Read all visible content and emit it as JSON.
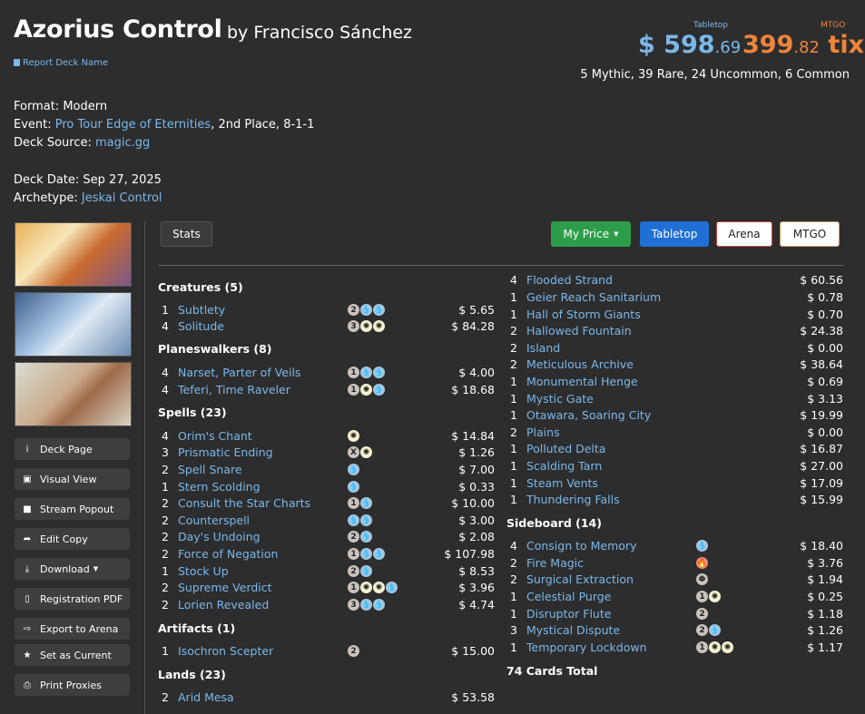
{
  "header": {
    "title": "Azorius Control",
    "author": "by Francisco Sánchez",
    "report_link": "Report Deck Name",
    "tabletop_label": "Tabletop",
    "mtgo_label": "MTGO",
    "tabletop_price_main": "$ 598",
    "tabletop_price_cents": ".69",
    "mtgo_price_main": "399",
    "mtgo_price_cents": ".82",
    "mtgo_price_unit": " tix",
    "rarity": "5 Mythic, 39 Rare, 24 Uncommon, 6 Common"
  },
  "info": {
    "format_label": "Format:",
    "format": "Modern",
    "event_label": "Event:",
    "event_link": "Pro Tour Edge of Eternities",
    "event_rest": ", 2nd Place, 8-1-1",
    "source_label": "Deck Source:",
    "source_link": "magic.gg",
    "date_label": "Deck Date:",
    "date": "Sep 27, 2025",
    "archetype_label": "Archetype:",
    "archetype_link": "Jeskai Control"
  },
  "sidebar": {
    "buttons": [
      {
        "label": "Deck Page",
        "icon": "info-icon"
      },
      {
        "label": "Visual View",
        "icon": "image-icon"
      },
      {
        "label": "Stream Popout",
        "icon": "video-icon"
      },
      {
        "label": "Edit Copy",
        "icon": "share-icon"
      },
      {
        "label": "Download",
        "icon": "download-icon"
      },
      {
        "label": "Registration PDF",
        "icon": "pdf-icon"
      },
      {
        "label": "Export to Arena",
        "icon": "export-icon"
      },
      {
        "label": "Set as Current",
        "icon": "star-icon"
      },
      {
        "label": "Print Proxies",
        "icon": "print-icon"
      }
    ]
  },
  "toolbar": {
    "stats": "Stats",
    "my_price": "My Price",
    "tabletop": "Tabletop",
    "arena": "Arena",
    "mtgo": "MTGO"
  },
  "colors": {
    "link": "#7ab8ea",
    "tabletop_price": "#7ab8ea",
    "mtgo_price": "#f0843a",
    "my_price_btn": "#2e9d4a",
    "tabletop_btn": "#1f6fd4"
  },
  "left_sections": [
    {
      "header": "Creatures (5)",
      "cards": [
        {
          "qty": "1",
          "name": "Subtlety",
          "cost": [
            "2",
            "U",
            "U"
          ],
          "price": "$ 5.65"
        },
        {
          "qty": "4",
          "name": "Solitude",
          "cost": [
            "3",
            "W",
            "W"
          ],
          "price": "$ 84.28"
        }
      ]
    },
    {
      "header": "Planeswalkers (8)",
      "cards": [
        {
          "qty": "4",
          "name": "Narset, Parter of Veils",
          "cost": [
            "1",
            "U",
            "U"
          ],
          "price": "$ 4.00"
        },
        {
          "qty": "4",
          "name": "Teferi, Time Raveler",
          "cost": [
            "1",
            "W",
            "U"
          ],
          "price": "$ 18.68"
        }
      ]
    },
    {
      "header": "Spells (23)",
      "cards": [
        {
          "qty": "4",
          "name": "Orim's Chant",
          "cost": [
            "W"
          ],
          "price": "$ 14.84"
        },
        {
          "qty": "3",
          "name": "Prismatic Ending",
          "cost": [
            "X",
            "W"
          ],
          "price": "$ 1.26"
        },
        {
          "qty": "2",
          "name": "Spell Snare",
          "cost": [
            "U"
          ],
          "price": "$ 7.00"
        },
        {
          "qty": "1",
          "name": "Stern Scolding",
          "cost": [
            "U"
          ],
          "price": "$ 0.33"
        },
        {
          "qty": "2",
          "name": "Consult the Star Charts",
          "cost": [
            "1",
            "U"
          ],
          "price": "$ 10.00"
        },
        {
          "qty": "2",
          "name": "Counterspell",
          "cost": [
            "U",
            "U"
          ],
          "price": "$ 3.00"
        },
        {
          "qty": "2",
          "name": "Day's Undoing",
          "cost": [
            "2",
            "U"
          ],
          "price": "$ 2.08"
        },
        {
          "qty": "2",
          "name": "Force of Negation",
          "cost": [
            "1",
            "U",
            "U"
          ],
          "price": "$ 107.98"
        },
        {
          "qty": "1",
          "name": "Stock Up",
          "cost": [
            "2",
            "U"
          ],
          "price": "$ 8.53"
        },
        {
          "qty": "2",
          "name": "Supreme Verdict",
          "cost": [
            "1",
            "W",
            "W",
            "U"
          ],
          "price": "$ 3.96"
        },
        {
          "qty": "2",
          "name": "Lorien Revealed",
          "cost": [
            "3",
            "U",
            "U"
          ],
          "price": "$ 4.74"
        }
      ]
    },
    {
      "header": "Artifacts (1)",
      "cards": [
        {
          "qty": "1",
          "name": "Isochron Scepter",
          "cost": [
            "2"
          ],
          "price": "$ 15.00"
        }
      ]
    },
    {
      "header": "Lands (23)",
      "cards": [
        {
          "qty": "2",
          "name": "Arid Mesa",
          "cost": [],
          "price": "$ 53.58"
        }
      ]
    }
  ],
  "right_lands": [
    {
      "qty": "4",
      "name": "Flooded Strand",
      "price": "$ 60.56"
    },
    {
      "qty": "1",
      "name": "Geier Reach Sanitarium",
      "price": "$ 0.78"
    },
    {
      "qty": "1",
      "name": "Hall of Storm Giants",
      "price": "$ 0.70"
    },
    {
      "qty": "2",
      "name": "Hallowed Fountain",
      "price": "$ 24.38"
    },
    {
      "qty": "2",
      "name": "Island",
      "price": "$ 0.00"
    },
    {
      "qty": "2",
      "name": "Meticulous Archive",
      "price": "$ 38.64"
    },
    {
      "qty": "1",
      "name": "Monumental Henge",
      "price": "$ 0.69"
    },
    {
      "qty": "1",
      "name": "Mystic Gate",
      "price": "$ 3.13"
    },
    {
      "qty": "1",
      "name": "Otawara, Soaring City",
      "price": "$ 19.99"
    },
    {
      "qty": "2",
      "name": "Plains",
      "price": "$ 0.00"
    },
    {
      "qty": "1",
      "name": "Polluted Delta",
      "price": "$ 16.87"
    },
    {
      "qty": "1",
      "name": "Scalding Tarn",
      "price": "$ 27.00"
    },
    {
      "qty": "1",
      "name": "Steam Vents",
      "price": "$ 17.09"
    },
    {
      "qty": "1",
      "name": "Thundering Falls",
      "price": "$ 15.99"
    }
  ],
  "sideboard": {
    "header": "Sideboard (14)",
    "cards": [
      {
        "qty": "4",
        "name": "Consign to Memory",
        "cost": [
          "U"
        ],
        "price": "$ 18.40"
      },
      {
        "qty": "2",
        "name": "Fire Magic",
        "cost": [
          "R"
        ],
        "price": "$ 3.76"
      },
      {
        "qty": "2",
        "name": "Surgical Extraction",
        "cost": [
          "P"
        ],
        "price": "$ 1.94"
      },
      {
        "qty": "1",
        "name": "Celestial Purge",
        "cost": [
          "1",
          "W"
        ],
        "price": "$ 0.25"
      },
      {
        "qty": "1",
        "name": "Disruptor Flute",
        "cost": [
          "2"
        ],
        "price": "$ 1.18"
      },
      {
        "qty": "3",
        "name": "Mystical Dispute",
        "cost": [
          "2",
          "U"
        ],
        "price": "$ 1.26"
      },
      {
        "qty": "1",
        "name": "Temporary Lockdown",
        "cost": [
          "1",
          "W",
          "W"
        ],
        "price": "$ 1.17"
      }
    ]
  },
  "total": "74 Cards Total"
}
